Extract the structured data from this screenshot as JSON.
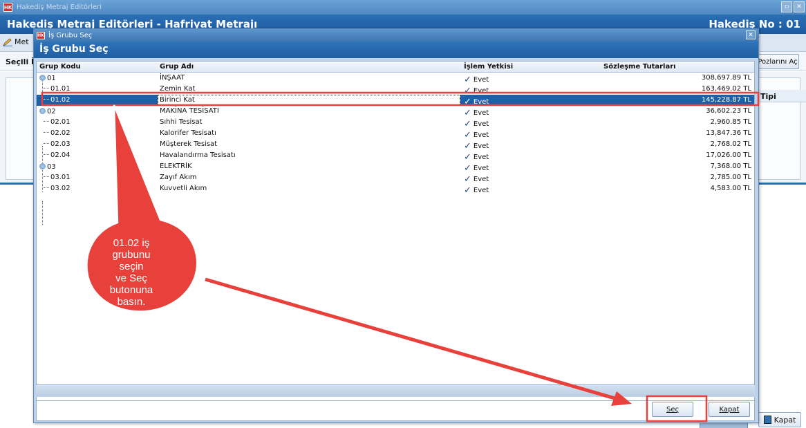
{
  "app": {
    "window_title": "Hakediş Metraj Editörleri",
    "header_title": "Hakediş Metraj Editörleri - Hafriyat Metrajı",
    "header_hakedis": "Hakediş No : 01",
    "toolbar_label": "Met",
    "subbar_label": "Seçili İ",
    "pozlar_button": "Pozlarını Aç",
    "tipi_column": "Tipi",
    "kapat_button": "Kapat"
  },
  "dialog": {
    "window_title": "İş Grubu Seç",
    "header": "İş Grubu Seç",
    "columns": {
      "code": "Grup Kodu",
      "name": "Grup Adı",
      "auth": "İşlem Yetkisi",
      "amount": "Sözleşme Tutarları"
    },
    "rows": [
      {
        "code": "01",
        "name": "İNŞAAT",
        "auth": "Evet",
        "amount": "308,697.89 TL"
      },
      {
        "code": "01.01",
        "name": "Zemin Kat",
        "auth": "Evet",
        "amount": "163,469.02 TL"
      },
      {
        "code": "01.02",
        "name": "Birinci Kat",
        "auth": "Evet",
        "amount": "145,228.87 TL"
      },
      {
        "code": "02",
        "name": "MAKİNA TESİSATI",
        "auth": "Evet",
        "amount": "36,602.23 TL"
      },
      {
        "code": "02.01",
        "name": "Sıhhi Tesisat",
        "auth": "Evet",
        "amount": "2,960.85 TL"
      },
      {
        "code": "02.02",
        "name": "Kalorifer Tesisatı",
        "auth": "Evet",
        "amount": "13,847.36 TL"
      },
      {
        "code": "02.03",
        "name": "Müşterek Tesisat",
        "auth": "Evet",
        "amount": "2,768.02 TL"
      },
      {
        "code": "02.04",
        "name": "Havalandırma Tesisatı",
        "auth": "Evet",
        "amount": "17,026.00 TL"
      },
      {
        "code": "03",
        "name": "ELEKTRİK",
        "auth": "Evet",
        "amount": "7,368.00 TL"
      },
      {
        "code": "03.01",
        "name": "Zayıf Akım",
        "auth": "Evet",
        "amount": "2,785.00 TL"
      },
      {
        "code": "03.02",
        "name": "Kuvvetli Akım",
        "auth": "Evet",
        "amount": "4,583.00 TL"
      }
    ],
    "sec_button": "Seç",
    "kapat_button": "Kapat"
  },
  "annotation": {
    "callout_lines": [
      "01.02 iş",
      "grubunu seçin",
      "ve Seç",
      "butonuna",
      "basın."
    ],
    "color": "#e8403a"
  }
}
